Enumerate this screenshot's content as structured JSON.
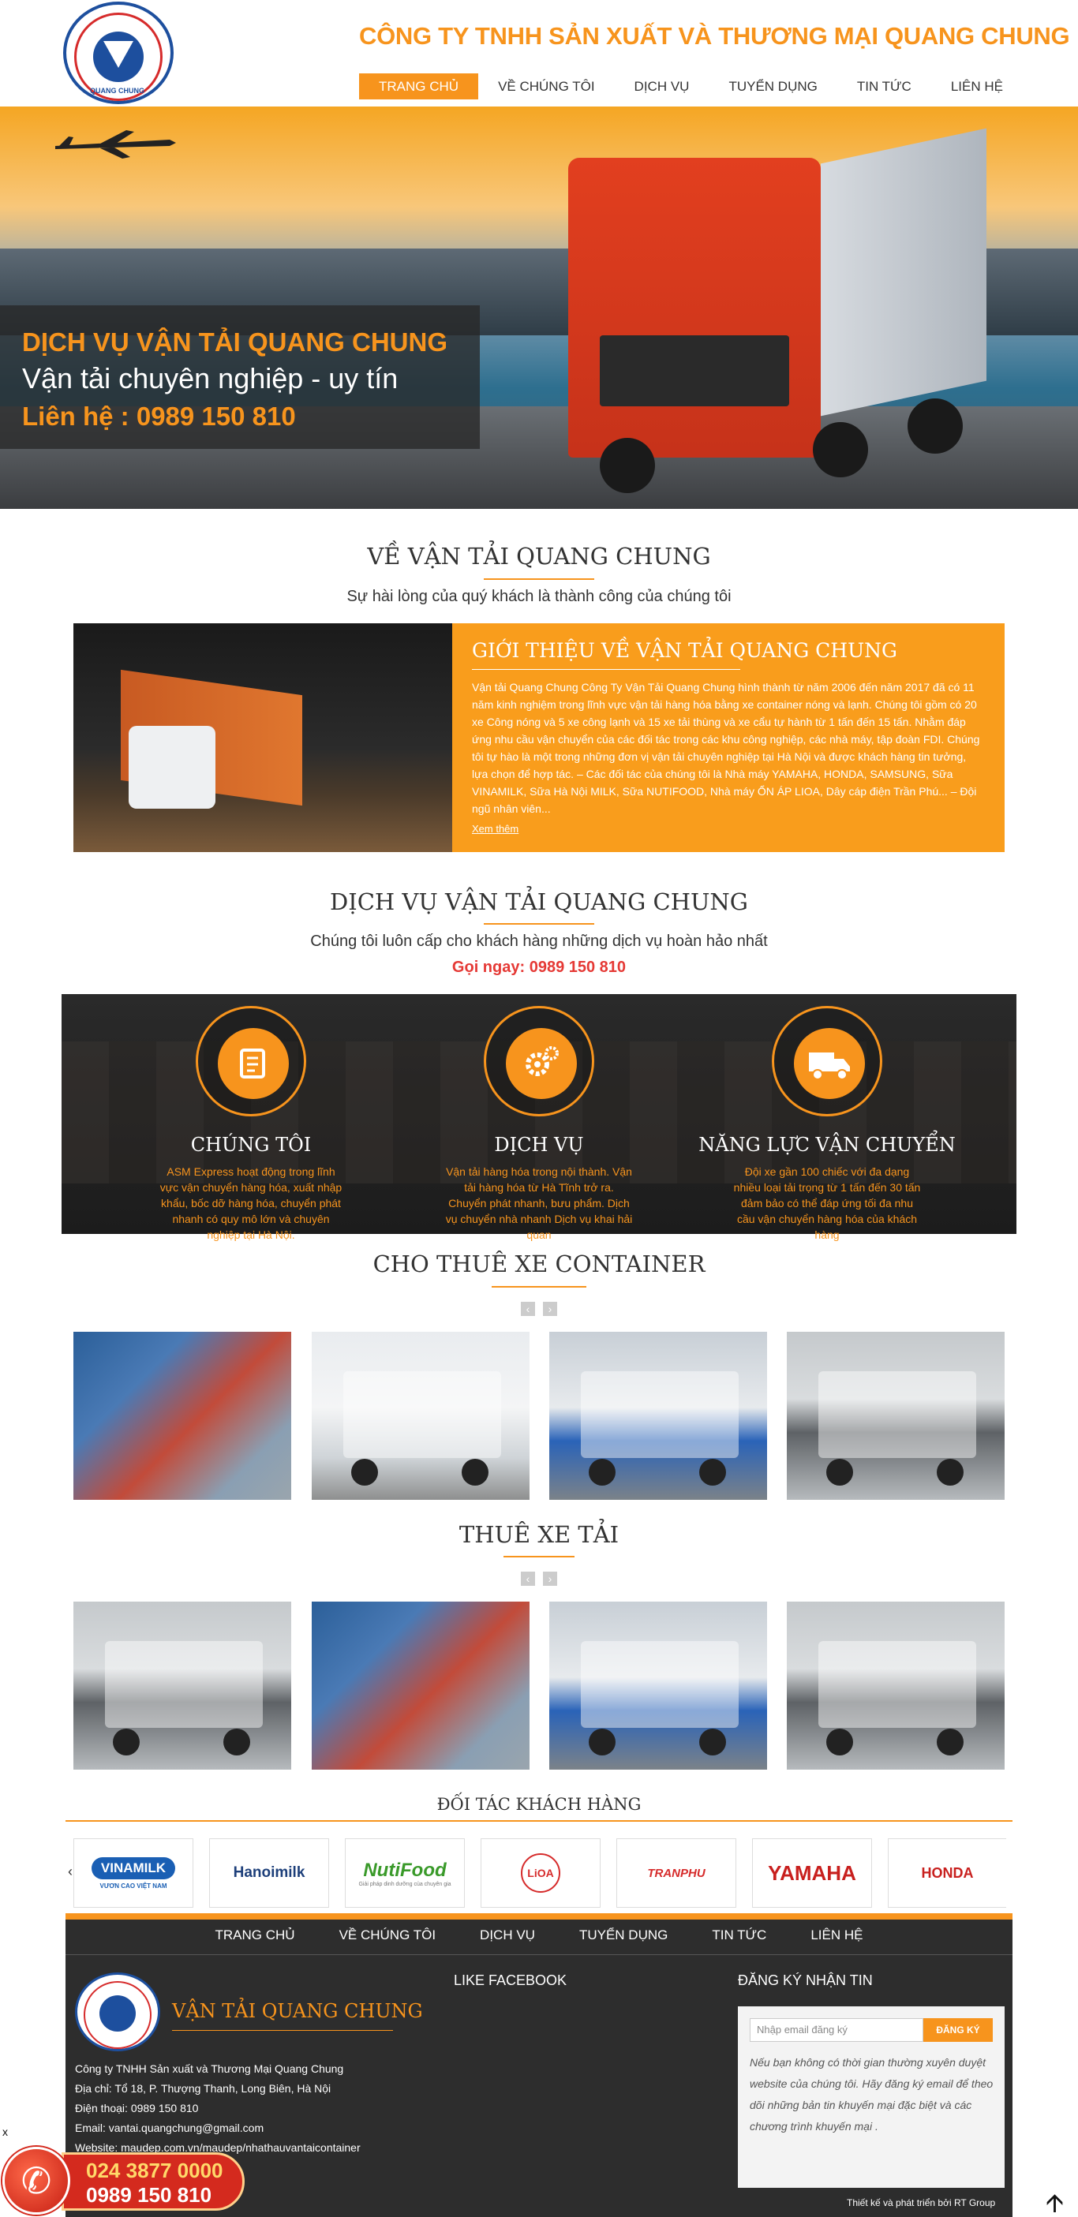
{
  "header": {
    "company_name": "CÔNG TY TNHH SẢN XUẤT VÀ THƯƠNG MẠI QUANG CHUNG",
    "logo_text": "QUANG CHUNG",
    "nav": [
      "TRANG CHỦ",
      "VỀ CHÚNG TÔI",
      "DỊCH VỤ",
      "TUYỂN DỤNG",
      "TIN TỨC",
      "LIÊN HỆ"
    ]
  },
  "banner": {
    "line1": "DỊCH VỤ VẬN TẢI QUANG CHUNG",
    "line2": "Vận tải chuyên nghiệp - uy tín",
    "line3": "Liên hệ : 0989 150 810"
  },
  "about": {
    "title": "VỀ VẬN TẢI QUANG CHUNG",
    "subtitle": "Sự hài lòng của quý khách là thành công của chúng tôi",
    "box_title": "GIỚI THIỆU VỀ VẬN TẢI QUANG CHUNG",
    "box_text": "Vận tải Quang Chung Công Ty  Vận Tải Quang Chung hình thành từ năm 2006 đến năm 2017 đã có 11 năm kinh nghiệm trong lĩnh vực vận tải hàng hóa bằng xe container nóng và lạnh. Chúng tôi gồm có 20 xe Công nóng và 5 xe công lạnh và 15 xe tải thùng và xe cẩu tự hành từ 1 tấn đến 15 tấn. Nhằm đáp ứng nhu cầu vận chuyển của các đối tác trong các khu công nghiệp, các nhà máy, tập đoàn FDI. Chúng tôi tự hào là một trong những đơn vị vận tải chuyên nghiệp tại Hà Nội và được khách hàng tin tưởng, lựa chọn để hợp tác. – Các đối tác của chúng tôi là Nhà máy YAMAHA, HONDA, SAMSUNG, Sữa VINAMILK, Sữa Hà Nội MILK, Sữa NUTIFOOD, Nhà máy ỔN ÁP LIOA, Dây cáp điện Trần Phú... – Đội ngũ nhân viên...",
    "more": "Xem thêm"
  },
  "services": {
    "title": "DỊCH VỤ VẬN TẢI QUANG CHUNG",
    "subtitle": "Chúng tôi luôn cấp cho khách hàng những dịch vụ hoàn hảo nhất",
    "call": "Gọi ngay: 0989 150 810",
    "features": [
      {
        "icon": "document-icon",
        "title": "CHÚNG TÔI",
        "text": "ASM Express hoạt động trong lĩnh vực vận chuyển hàng hóa, xuất nhập khẩu, bốc dỡ hàng hóa, chuyển phát nhanh có quy mô lớn và chuyên nghiệp tại Hà Nội."
      },
      {
        "icon": "gears-icon",
        "title": "DỊCH VỤ",
        "text": "Vận tải hàng hóa trong nội thành. Vận tải hàng hóa từ Hà Tĩnh trở ra. Chuyển phát nhanh, bưu phẩm. Dịch vụ chuyển nhà nhanh Dịch vụ khai hải quan"
      },
      {
        "icon": "truck-icon",
        "title": "NĂNG LỰC VẬN CHUYỂN",
        "text": "Đội xe gần 100 chiếc với đa dạng nhiều loại tải trọng từ 1 tấn đến 30 tấn đảm bảo có thể đáp ứng tối đa nhu cầu vận chuyển hàng hóa của khách hàng"
      }
    ]
  },
  "container_rental": {
    "title": "CHO THUÊ XE CONTAINER"
  },
  "truck_rental": {
    "title": "THUÊ XE TẢI"
  },
  "partners": {
    "title": "ĐỐI TÁC KHÁCH HÀNG",
    "logos": [
      "VINAMILK",
      "Hanoimilk",
      "NutiFood",
      "LiOA",
      "TRANPHU",
      "YAMAHA",
      "HONDA"
    ],
    "vinamilk_tag": "VƯƠN CAO VIỆT NAM",
    "nutifood_tag": "Giải pháp dinh dưỡng của chuyên gia",
    "prev": "‹",
    "next": "›"
  },
  "footer": {
    "nav": [
      "TRANG CHỦ",
      "VỀ CHÚNG TÔI",
      "DỊCH VỤ",
      "TUYỂN DỤNG",
      "TIN TỨC",
      "LIÊN HỆ"
    ],
    "brand": "VẬN TẢI QUANG CHUNG",
    "info": [
      "Công ty TNHH Sản xuất và Thương Mại Quang Chung",
      "Địa chỉ: Tổ 18, P. Thượng Thanh, Long Biên, Hà Nội",
      "Điện thoại: 0989 150 810",
      "Email: vantai.quangchung@gmail.com",
      "Website: maudep.com.vn/maudep/nhathauvantaicontainer"
    ],
    "facebook_title": "LIKE FACEBOOK",
    "subscribe_title": "ĐĂNG KÝ NHẬN TIN",
    "email_placeholder": "Nhập email đăng ký",
    "subscribe_button": "ĐĂNG KÝ",
    "subscribe_text": "Nếu bạn không có thời gian thường xuyên duyệt website của chúng tôi. Hãy đăng ký email để theo dõi những bản tin khuyến mại đặc biệt và các chương trình khuyến mại .",
    "credit": "Thiết kế và phát triển bởi RT Group"
  },
  "hotline": {
    "phone1": "024 3877 0000",
    "phone2": "0989 150 810",
    "close": "x"
  },
  "colors": {
    "accent": "#f7941d",
    "red": "#e53935",
    "footer": "#2d2d2d"
  }
}
